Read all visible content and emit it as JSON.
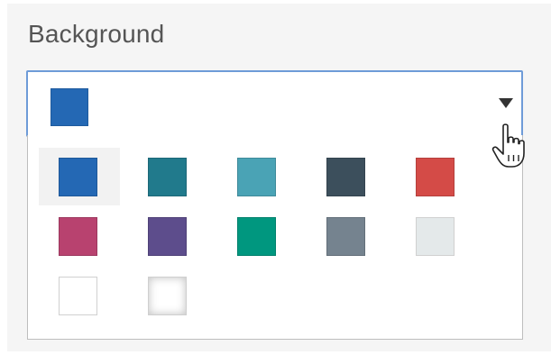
{
  "field": {
    "label": "Background"
  },
  "select": {
    "selected_color": "#2468b4"
  },
  "palette": {
    "colors": [
      "#2468b4",
      "#217a8c",
      "#4aa3b5",
      "#3c4f5c",
      "#d44b47",
      "#b8426f",
      "#5d4d8c",
      "#00977f",
      "#75838f",
      "#e4e9ea",
      "#ffffff",
      "#ffffff"
    ],
    "hovered_index": 0
  },
  "colors": {
    "panel_bg": "#f5f5f5",
    "focus_border": "#6e9bd8"
  }
}
